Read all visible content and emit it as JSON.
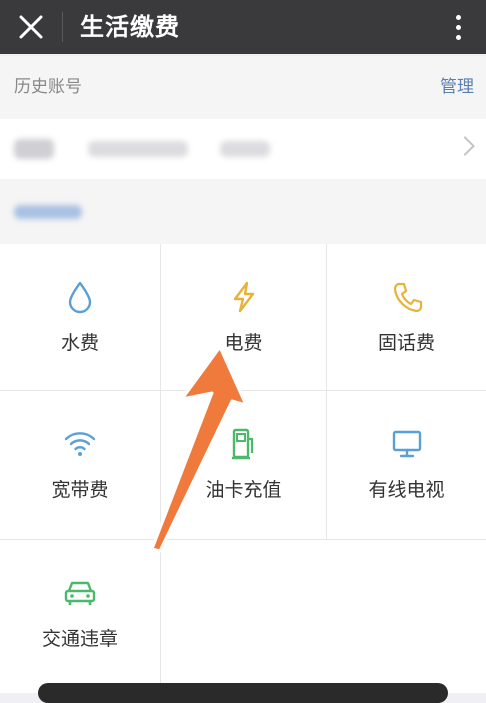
{
  "header": {
    "title": "生活缴费"
  },
  "history": {
    "label": "历史账号",
    "manage": "管理"
  },
  "services": [
    {
      "label": "水费",
      "icon": "water-drop-icon",
      "color": "#5aa0d6"
    },
    {
      "label": "电费",
      "icon": "lightning-icon",
      "color": "#e8b23a"
    },
    {
      "label": "固话费",
      "icon": "phone-icon",
      "color": "#e8b23a"
    },
    {
      "label": "宽带费",
      "icon": "wifi-icon",
      "color": "#5aa0d6"
    },
    {
      "label": "油卡充值",
      "icon": "fuel-pump-icon",
      "color": "#4cb86a"
    },
    {
      "label": "有线电视",
      "icon": "monitor-icon",
      "color": "#5aa0d6"
    },
    {
      "label": "交通违章",
      "icon": "car-icon",
      "color": "#4cb86a"
    }
  ],
  "colors": {
    "topbar": "#3a3a3c",
    "link": "#5a7fb0",
    "arrow": "#f07a3c"
  }
}
